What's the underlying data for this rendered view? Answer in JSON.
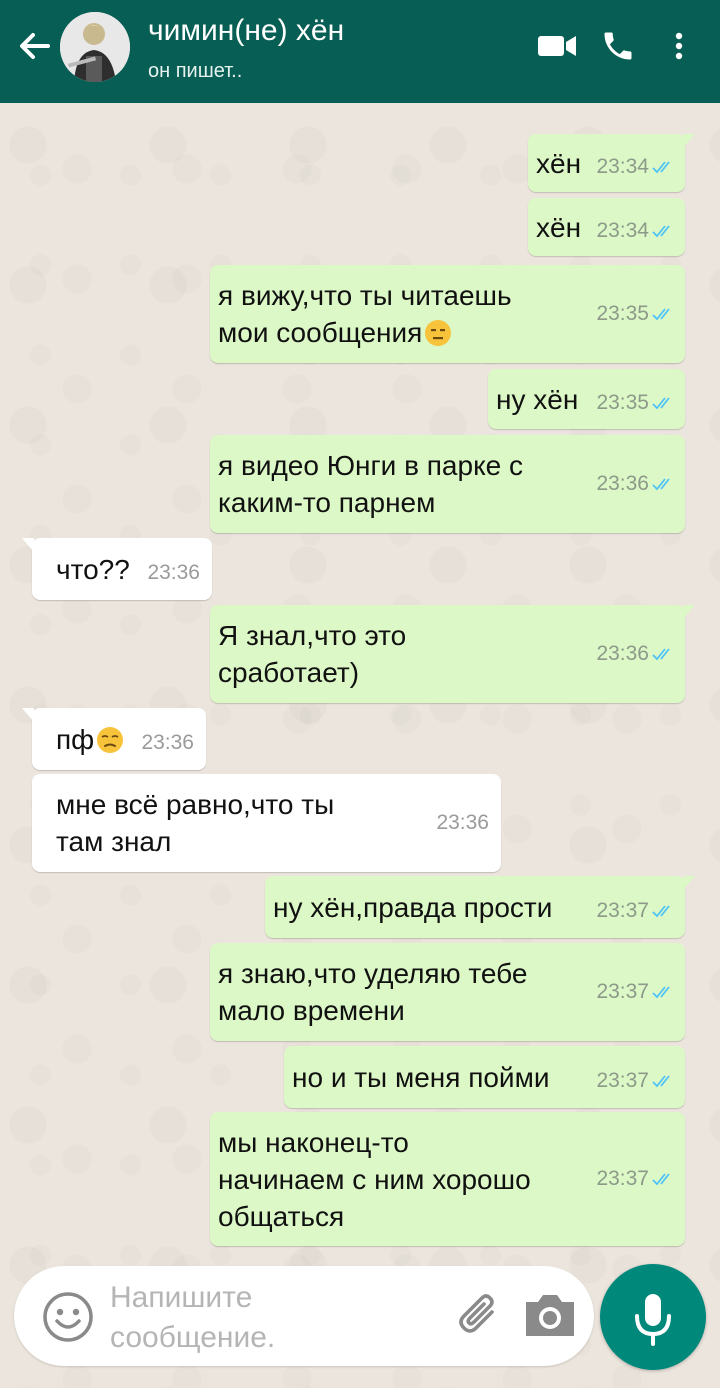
{
  "header": {
    "title": "чимин(не) хён",
    "subtitle": "он пишет.."
  },
  "colors": {
    "header_bg": "#075e54",
    "outgoing_bubble": "#dcf8c6",
    "incoming_bubble": "#ffffff",
    "read_ticks": "#4fc3f7",
    "mic_button": "#00897b"
  },
  "messages": [
    {
      "dir": "out",
      "lines": [
        "хён"
      ],
      "time": "23:34",
      "ticks": "read"
    },
    {
      "dir": "out",
      "lines": [
        "хён"
      ],
      "time": "23:34",
      "ticks": "read"
    },
    {
      "dir": "out",
      "lines": [
        "я вижу,что ты читаешь",
        "мои сообщения"
      ],
      "emoji": "expressionless-face",
      "time": "23:35",
      "ticks": "read"
    },
    {
      "dir": "out",
      "lines": [
        "ну хён"
      ],
      "time": "23:35",
      "ticks": "read"
    },
    {
      "dir": "out",
      "lines": [
        "я видео Юнги в парке с",
        "каким-то парнем"
      ],
      "time": "23:36",
      "ticks": "read"
    },
    {
      "dir": "in",
      "lines": [
        "что??"
      ],
      "time": "23:36"
    },
    {
      "dir": "out",
      "lines": [
        "Я знал,что это",
        "сработает)"
      ],
      "time": "23:36",
      "ticks": "read"
    },
    {
      "dir": "in",
      "lines": [
        "пф"
      ],
      "emoji": "unamused-face",
      "time": "23:36"
    },
    {
      "dir": "in",
      "lines": [
        "мне всё равно,что ты",
        "там знал"
      ],
      "time": "23:36"
    },
    {
      "dir": "out",
      "lines": [
        "ну хён,правда прости"
      ],
      "time": "23:37",
      "ticks": "read"
    },
    {
      "dir": "out",
      "lines": [
        "я знаю,что уделяю тебе",
        "мало времени"
      ],
      "time": "23:37",
      "ticks": "read"
    },
    {
      "dir": "out",
      "lines": [
        "но и ты меня пойми"
      ],
      "time": "23:37",
      "ticks": "read"
    },
    {
      "dir": "out",
      "lines": [
        "мы наконец-то",
        "начинаем с ним хорошо",
        "общаться"
      ],
      "time": "23:37",
      "ticks": "read"
    }
  ],
  "composer": {
    "placeholder_line1": "Напишите",
    "placeholder_line2": "сообщение."
  },
  "icons": {
    "back": "arrow-left-icon",
    "video": "video-call-icon",
    "call": "phone-icon",
    "menu": "more-vert-icon",
    "emoji": "emoji-icon",
    "attach": "paperclip-icon",
    "camera": "camera-icon",
    "mic": "mic-icon"
  }
}
